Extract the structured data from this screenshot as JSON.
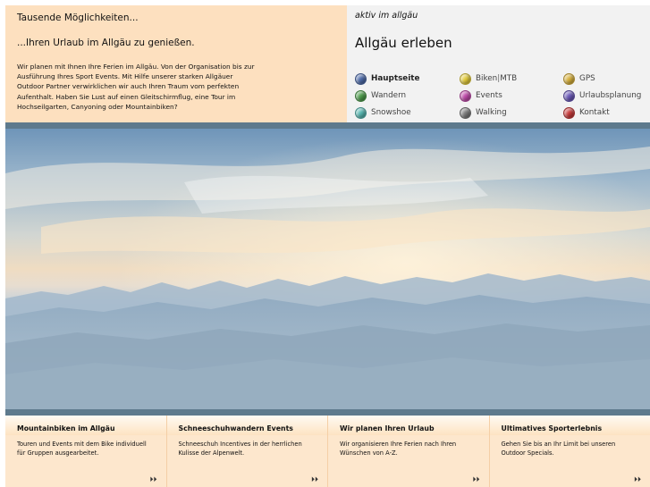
{
  "intro": {
    "tagline": "Tausende Möglichkeiten...",
    "headline": "...Ihren Urlaub im Allgäu zu genießen.",
    "text": "Wir planen mit Ihnen Ihre Ferien im Allgäu. Von der Organisation bis zur Ausführung Ihres Sport Events. Mit Hilfe unserer starken Allgäuer Outdoor Partner verwirklichen wir auch Ihren Traum vom perfekten Aufenthalt. Haben Sie Lust auf einen Gleitschirmflug, eine Tour im Hochseilgarten, Canyoning oder Mountainbiken?"
  },
  "site": {
    "tagline": "aktiv im allgäu",
    "title": "Allgäu erleben"
  },
  "nav": {
    "items": [
      {
        "label": "Hauptseite",
        "color": "#4d6aa8",
        "active": true
      },
      {
        "label": "Biken",
        "label_sep": " | ",
        "label_extra": "MTB",
        "color": "#e3cc3c",
        "active": false
      },
      {
        "label": "GPS",
        "color": "#d8b13c",
        "active": false
      },
      {
        "label": "Wandern",
        "color": "#4c9b4a",
        "active": false
      },
      {
        "label": "Events",
        "color": "#c04aaa",
        "active": false
      },
      {
        "label": "Urlaubsplanung",
        "color": "#6a58b8",
        "active": false
      },
      {
        "label": "Snowshoe",
        "color": "#56b6b0",
        "active": false
      },
      {
        "label": "Walking",
        "color": "#7c7c7c",
        "active": false
      },
      {
        "label": "Kontakt",
        "color": "#c83a3a",
        "active": false
      }
    ]
  },
  "features": [
    {
      "title": "Mountainbiken im Allgäu",
      "text": "Touren und Events mit dem Bike individuell für Gruppen ausgearbeitet.",
      "more": "⏵⏵"
    },
    {
      "title": "Schneeschuhwandern Events",
      "text": "Schneeschuh Incentives in der herrlichen Kulisse der Alpenwelt.",
      "more": "⏵⏵"
    },
    {
      "title": "Wir planen Ihren Urlaub",
      "text": "Wir organisieren Ihre Ferien nach Ihren Wünschen von A-Z.",
      "more": "⏵⏵"
    },
    {
      "title": "Ultimatives Sporterlebnis",
      "text": "Gehen Sie bis an Ihr Limit bei unseren Outdoor Specials.",
      "more": "⏵⏵"
    }
  ],
  "colors": {
    "intro_bg": "#fde0bf",
    "nav_bg": "#f2f2f2",
    "band": "#5e7a8d",
    "feature_bg": "#fde7cd"
  }
}
